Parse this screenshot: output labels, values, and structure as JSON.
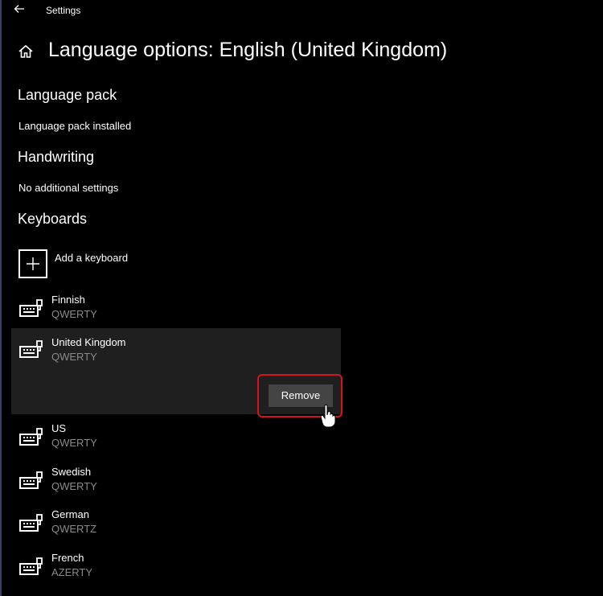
{
  "window": {
    "app_title": "Settings"
  },
  "header": {
    "title": "Language options: English (United Kingdom)"
  },
  "sections": {
    "language_pack": {
      "title": "Language pack",
      "status": "Language pack installed"
    },
    "handwriting": {
      "title": "Handwriting",
      "status": "No additional settings"
    },
    "keyboards": {
      "title": "Keyboards",
      "add_label": "Add a keyboard",
      "items": [
        {
          "name": "Finnish",
          "layout": "QWERTY"
        },
        {
          "name": "United Kingdom",
          "layout": "QWERTY",
          "selected": true
        },
        {
          "name": "US",
          "layout": "QWERTY"
        },
        {
          "name": "Swedish",
          "layout": "QWERTY"
        },
        {
          "name": "German",
          "layout": "QWERTZ"
        },
        {
          "name": "French",
          "layout": "AZERTY"
        }
      ],
      "remove_label": "Remove"
    }
  },
  "colors": {
    "background": "#000000",
    "selected_row": "#1f1f1f",
    "button": "#444444",
    "highlight": "#d3141c",
    "secondary_text": "#8a8a8a"
  }
}
